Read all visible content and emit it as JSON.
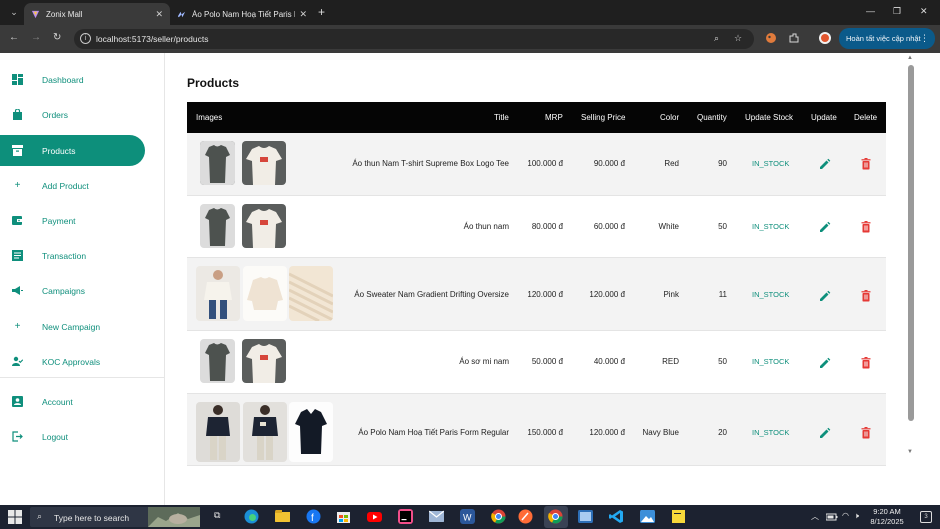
{
  "browser": {
    "tabs": [
      {
        "label": "Zonix Mall",
        "active": true
      },
      {
        "label": "Áo Polo Nam Hoạ Tiết Paris Fo",
        "active": false
      }
    ],
    "url": "localhost:5173/seller/products",
    "update_button": "Hoàn tất việc cập nhật"
  },
  "sidebar": {
    "items": [
      {
        "label": "Dashboard",
        "icon": "dashboard-icon",
        "active": false
      },
      {
        "label": "Orders",
        "icon": "shopping-bag-icon",
        "active": false
      },
      {
        "label": "Products",
        "icon": "inventory-icon",
        "active": true
      },
      {
        "label": "Add Product",
        "icon": "plus-icon",
        "active": false
      },
      {
        "label": "Payment",
        "icon": "payment-icon",
        "active": false
      },
      {
        "label": "Transaction",
        "icon": "receipt-icon",
        "active": false
      },
      {
        "label": "Campaigns",
        "icon": "campaign-icon",
        "active": false
      },
      {
        "label": "New Campaign",
        "icon": "plus-icon",
        "active": false
      },
      {
        "label": "KOC Approvals",
        "icon": "person-check-icon",
        "active": false
      }
    ],
    "bottom_items": [
      {
        "label": "Account",
        "icon": "account-icon"
      },
      {
        "label": "Logout",
        "icon": "logout-icon"
      }
    ]
  },
  "main": {
    "title": "Products",
    "columns": [
      "Images",
      "Title",
      "MRP",
      "Selling Price",
      "Color",
      "Quantity",
      "Update Stock",
      "Update",
      "Delete"
    ],
    "rows": [
      {
        "images": [
          "grey-shirt",
          "white-shirt"
        ],
        "title": "Áo thun Nam T-shirt Supreme Box Logo Tee",
        "mrp": "100.000 đ",
        "selling": "90.000 đ",
        "color": "Red",
        "quantity": "90",
        "stock": "IN_STOCK"
      },
      {
        "images": [
          "grey-shirt",
          "white-shirt"
        ],
        "title": "Áo thun nam",
        "mrp": "80.000 đ",
        "selling": "60.000 đ",
        "color": "White",
        "quantity": "50",
        "stock": "IN_STOCK"
      },
      {
        "images": [
          "sweater-model",
          "sweater-flat",
          "sweater-knit"
        ],
        "title": "Áo Sweater Nam Gradient Drifting Oversize",
        "mrp": "120.000 đ",
        "selling": "120.000 đ",
        "color": "Pink",
        "quantity": "11",
        "stock": "IN_STOCK"
      },
      {
        "images": [
          "grey-shirt",
          "white-shirt"
        ],
        "title": "Áo sơ mi nam",
        "mrp": "50.000 đ",
        "selling": "40.000 đ",
        "color": "RED",
        "quantity": "50",
        "stock": "IN_STOCK"
      },
      {
        "images": [
          "polo-model-back",
          "polo-model-front",
          "polo-flat"
        ],
        "title": "Áo Polo Nam Hoạ Tiết Paris Form Regular",
        "mrp": "150.000 đ",
        "selling": "120.000 đ",
        "color": "Navy Blue",
        "quantity": "20",
        "stock": "IN_STOCK"
      }
    ]
  },
  "taskbar": {
    "search_placeholder": "Type here to search",
    "time": "9:20 AM",
    "date": "8/12/2025",
    "notification_count": "3"
  },
  "colors": {
    "accent": "#0d8f7b",
    "header_bg": "#050505",
    "delete_red": "#e53935"
  }
}
